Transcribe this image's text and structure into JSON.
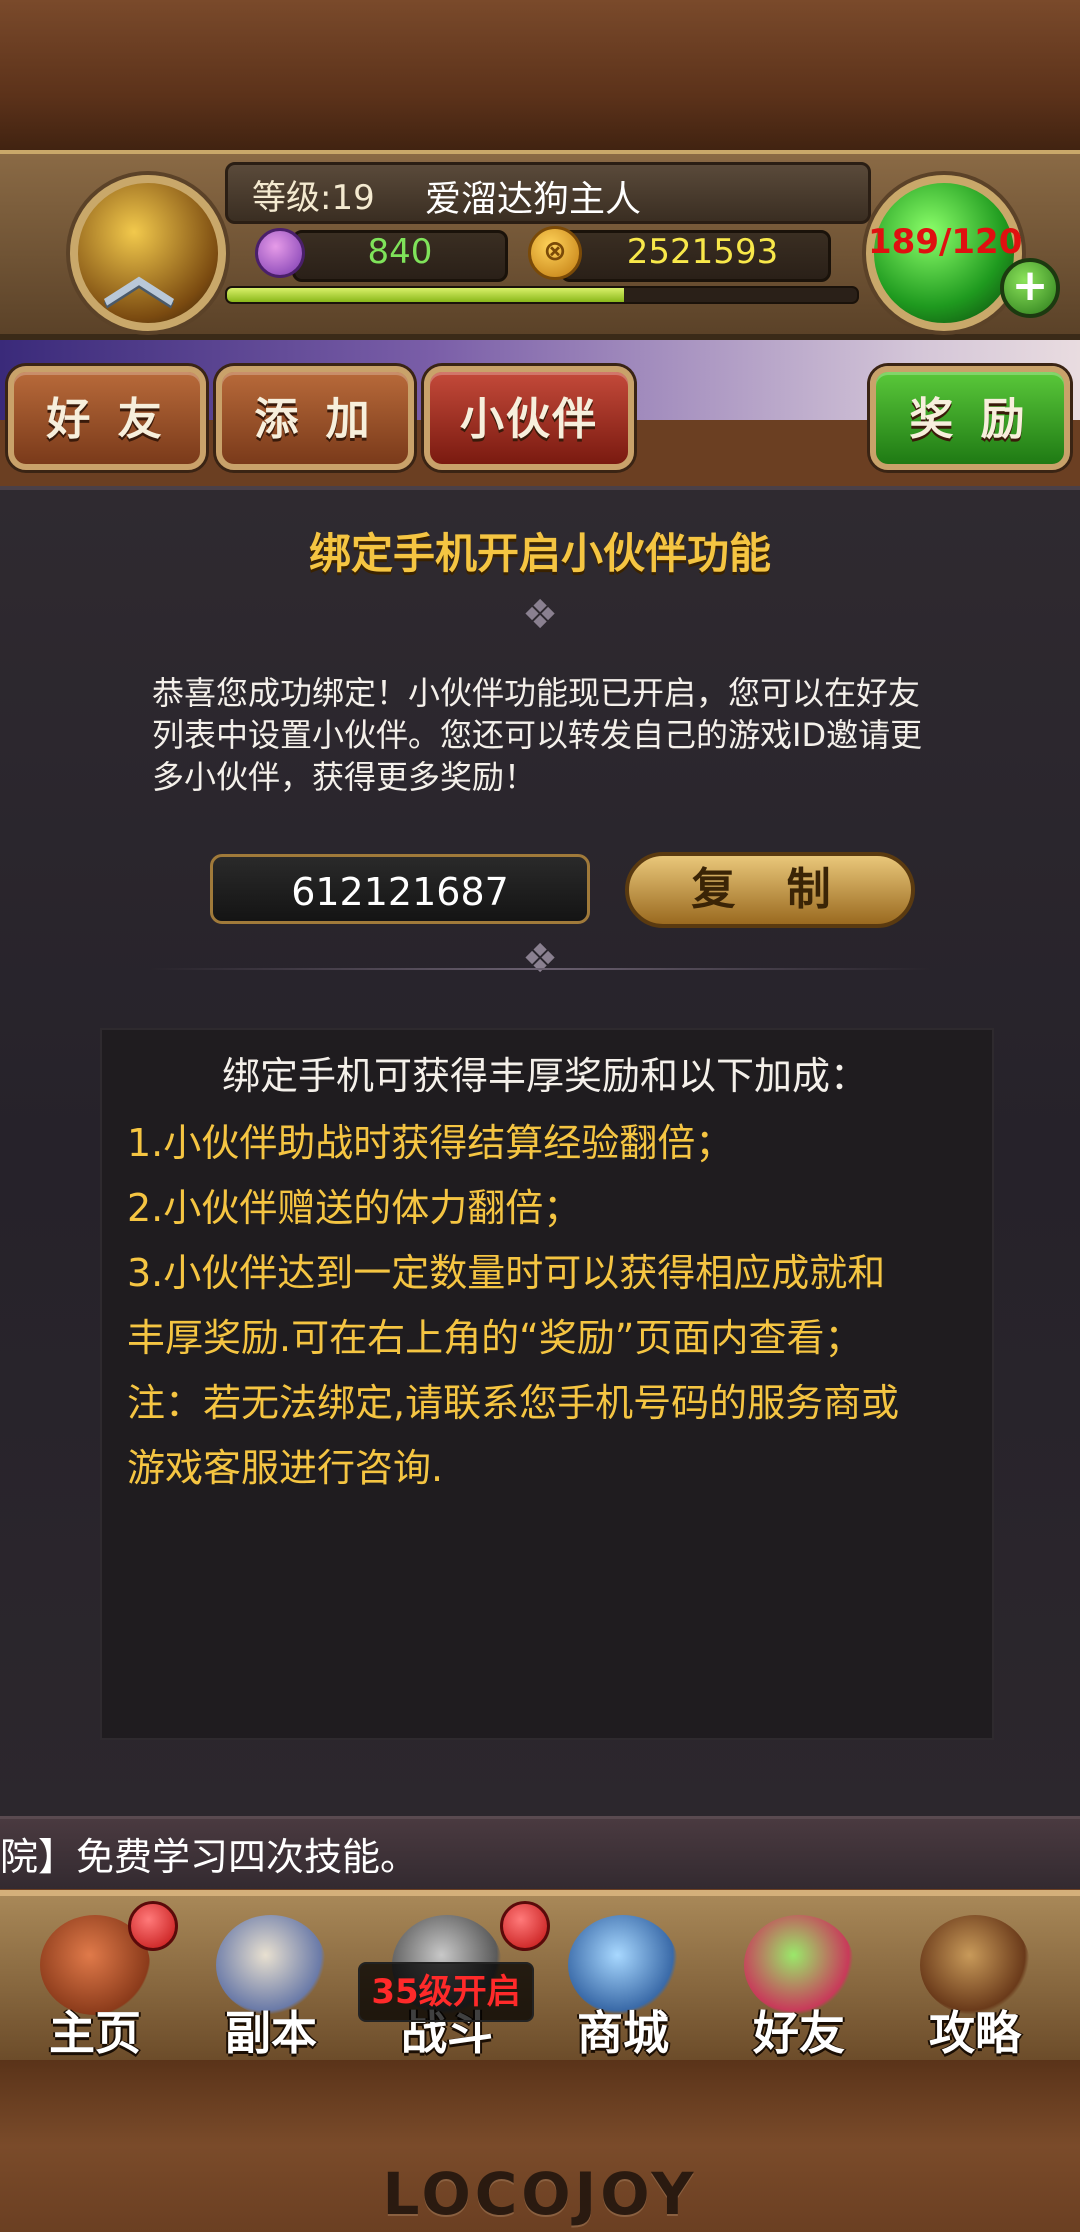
{
  "status": {
    "level": "等级:19",
    "player_name": "爱溜达狗主人",
    "gems": "840",
    "gold": "2521593",
    "stamina": "189/120",
    "xp_progress": 0.63
  },
  "tabs": {
    "friends": "好 友",
    "add": "添 加",
    "partner": "小伙伴",
    "reward": "奖 励"
  },
  "panel": {
    "title": "绑定手机开启小伙伴功能",
    "congrats": "恭喜您成功绑定！小伙伴功能现已开启，您可以在好友列表中设置小伙伴。您还可以转发自己的游戏ID邀请更多小伙伴，获得更多奖励！",
    "game_id": "612121687",
    "copy_label": "复 制"
  },
  "info": {
    "heading": "绑定手机可获得丰厚奖励和以下加成：",
    "lines": [
      "1.小伙伴助战时获得结算经验翻倍；",
      "2.小伙伴赠送的体力翻倍；",
      "3.小伙伴达到一定数量时可以获得相应成就和",
      "丰厚奖励.可在右上角的“奖励”页面内查看；",
      "注：若无法绑定,请联系您手机号码的服务商或",
      "游戏客服进行咨询."
    ]
  },
  "ticker": "院】免费学习四次技能。",
  "nav": {
    "home": "主页",
    "dungeon": "副本",
    "battle": "战斗",
    "battle_lock": "35级开启",
    "shop": "商城",
    "friends": "好友",
    "guide": "攻略"
  },
  "brand": "LOCOJOY",
  "colors": {
    "accent_gold": "#f5c542",
    "gem_green": "#7fe35a",
    "gold_yellow": "#f8e84a",
    "stamina_red": "#e01010"
  }
}
